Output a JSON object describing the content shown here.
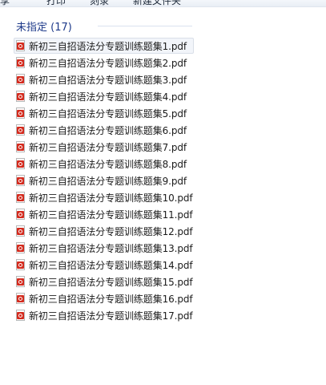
{
  "toolbar": {
    "items": [
      "享",
      "打印",
      "刻录",
      "新建文件夹"
    ]
  },
  "group": {
    "title": "未指定 (17)"
  },
  "files": [
    {
      "name": "新初三自招语法分专题训练题集1.pdf",
      "icon": "pdf-icon"
    },
    {
      "name": "新初三自招语法分专题训练题集2.pdf",
      "icon": "pdf-icon"
    },
    {
      "name": "新初三自招语法分专题训练题集3.pdf",
      "icon": "pdf-icon"
    },
    {
      "name": "新初三自招语法分专题训练题集4.pdf",
      "icon": "pdf-icon"
    },
    {
      "name": "新初三自招语法分专题训练题集5.pdf",
      "icon": "pdf-icon"
    },
    {
      "name": "新初三自招语法分专题训练题集6.pdf",
      "icon": "pdf-icon"
    },
    {
      "name": "新初三自招语法分专题训练题集7.pdf",
      "icon": "pdf-icon"
    },
    {
      "name": "新初三自招语法分专题训练题集8.pdf",
      "icon": "pdf-icon"
    },
    {
      "name": "新初三自招语法分专题训练题集9.pdf",
      "icon": "pdf-icon"
    },
    {
      "name": "新初三自招语法分专题训练题集10.pdf",
      "icon": "pdf-icon"
    },
    {
      "name": "新初三自招语法分专题训练题集11.pdf",
      "icon": "pdf-icon"
    },
    {
      "name": "新初三自招语法分专题训练题集12.pdf",
      "icon": "pdf-icon"
    },
    {
      "name": "新初三自招语法分专题训练题集13.pdf",
      "icon": "pdf-icon"
    },
    {
      "name": "新初三自招语法分专题训练题集14.pdf",
      "icon": "pdf-icon"
    },
    {
      "name": "新初三自招语法分专题训练题集15.pdf",
      "icon": "pdf-icon"
    },
    {
      "name": "新初三自招语法分专题训练题集16.pdf",
      "icon": "pdf-icon"
    },
    {
      "name": "新初三自招语法分专题训练题集17.pdf",
      "icon": "pdf-icon"
    }
  ],
  "colors": {
    "group_title": "#1e3a8a",
    "pdf_red": "#d42b1e",
    "background": "#ffffff"
  }
}
